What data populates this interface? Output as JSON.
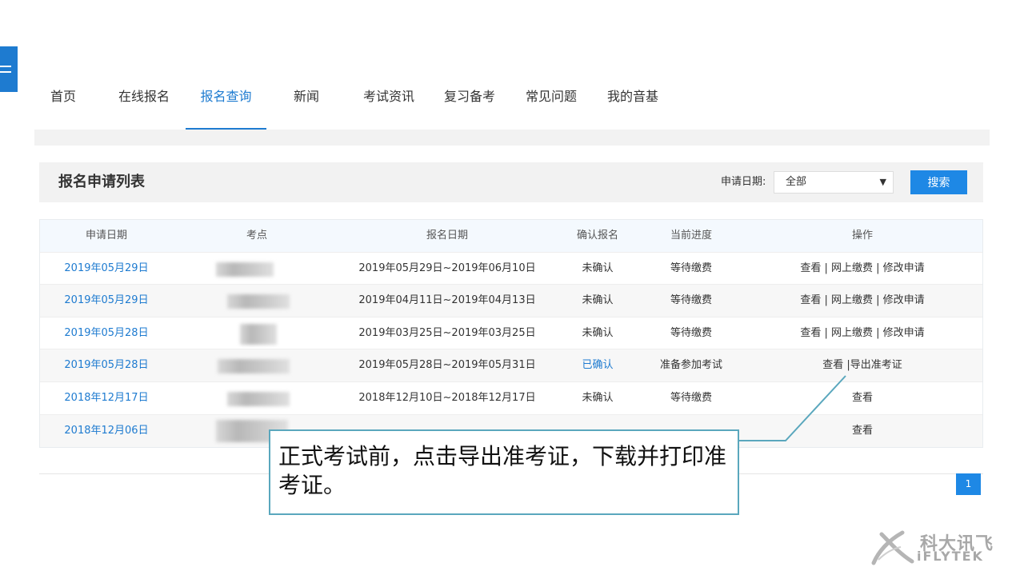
{
  "nav": {
    "items": [
      {
        "label": "首页"
      },
      {
        "label": "在线报名"
      },
      {
        "label": "报名查询"
      },
      {
        "label": "新闻"
      },
      {
        "label": "考试资讯"
      },
      {
        "label": "复习备考"
      },
      {
        "label": "常见问题"
      },
      {
        "label": "我的音基"
      }
    ],
    "active_index": 2
  },
  "list": {
    "title": "报名申请列表",
    "filter_label": "申请日期:",
    "filter_value": "全部",
    "search_label": "搜索"
  },
  "table": {
    "headers": [
      "申请日期",
      "考点",
      "报名日期",
      "确认报名",
      "当前进度",
      "操作"
    ],
    "rows": [
      {
        "date": "2019年05月29日",
        "period": "2019年05月29日~2019年06月10日",
        "confirm": "未确认",
        "progress": "等待缴费",
        "ops": "查看 | 网上缴费 | 修改申请"
      },
      {
        "date": "2019年05月29日",
        "period": "2019年04月11日~2019年04月13日",
        "confirm": "未确认",
        "progress": "等待缴费",
        "ops": "查看 | 网上缴费 | 修改申请"
      },
      {
        "date": "2019年05月28日",
        "period": "2019年03月25日~2019年03月25日",
        "confirm": "未确认",
        "progress": "等待缴费",
        "ops": "查看 | 网上缴费 | 修改申请"
      },
      {
        "date": "2019年05月28日",
        "period": "2019年05月28日~2019年05月31日",
        "confirm": "已确认",
        "progress": "准备参加考试",
        "ops": "查看 |导出准考证"
      },
      {
        "date": "2018年12月17日",
        "period": "2018年12月10日~2018年12月17日",
        "confirm": "未确认",
        "progress": "等待缴费",
        "ops": "查看"
      },
      {
        "date": "2018年12月06日",
        "period": "",
        "confirm": "",
        "progress": "",
        "ops": "查看"
      }
    ]
  },
  "pagination": {
    "current": "1"
  },
  "callout": {
    "text": "正式考试前，点击导出准考证，下载并打印准考证。"
  },
  "logo": {
    "cn": "科大讯飞",
    "en": "iFLYTEK"
  },
  "colors": {
    "accent": "#1e7bd0",
    "button": "#1e88e5",
    "callout_border": "#5aa7bd"
  }
}
